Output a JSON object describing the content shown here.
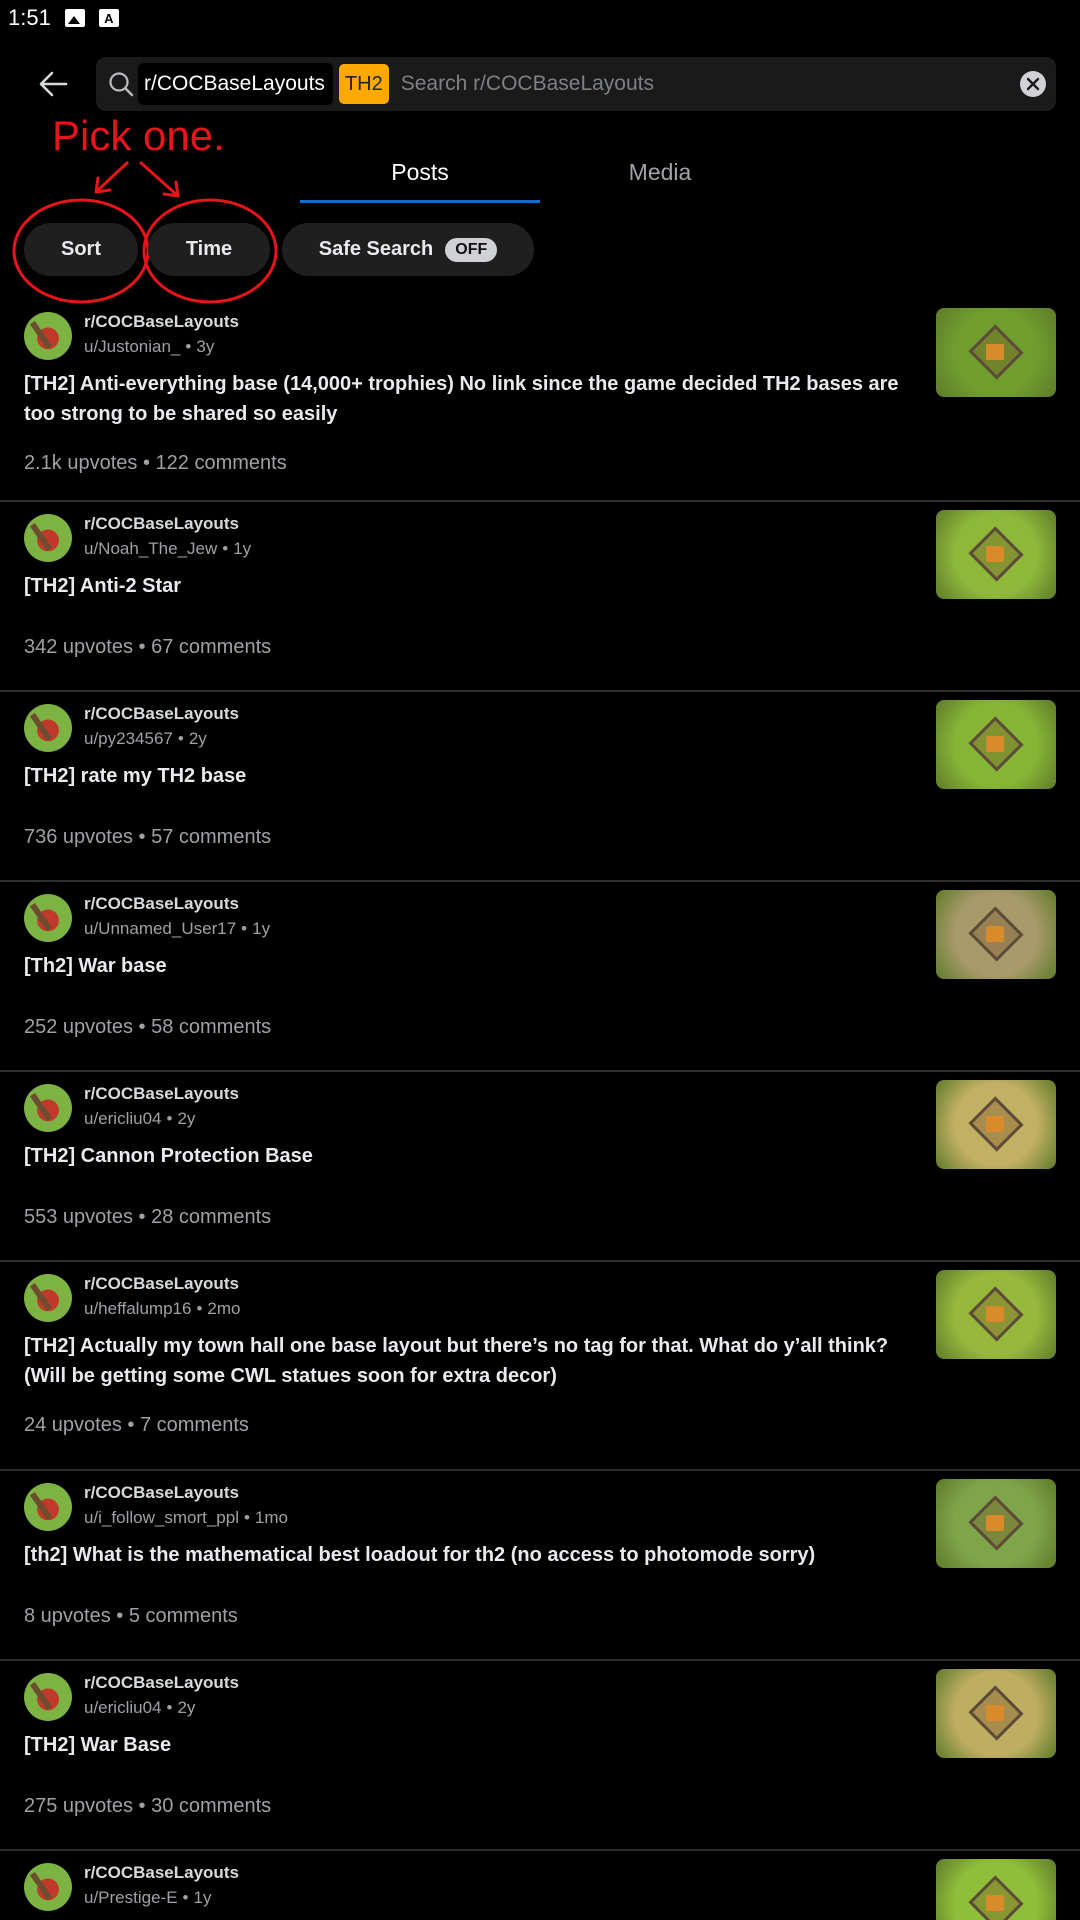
{
  "status_bar": {
    "time": "1:51"
  },
  "search": {
    "subreddit_chip": "r/COCBaseLayouts",
    "flair_chip": "TH2",
    "placeholder": "Search r/COCBaseLayouts"
  },
  "annotation": {
    "text": "Pick one.",
    "color": "#e8141b"
  },
  "tabs": [
    {
      "label": "Posts",
      "active": true
    },
    {
      "label": "Media",
      "active": false
    }
  ],
  "filters": {
    "sort": "Sort",
    "time": "Time",
    "safe_search": "Safe Search",
    "safe_search_state": "OFF"
  },
  "accent_color": "#0a6fcf",
  "posts": [
    {
      "subreddit": "r/COCBaseLayouts",
      "author": "u/Justonian_",
      "age": "3y",
      "title": "[TH2] Anti-everything base (14,000+ trophies) No link since the game decided TH2 bases are too strong to be shared so easily",
      "stats": "2.1k upvotes • 122 comments",
      "thumb_color": "#6f9e2e"
    },
    {
      "subreddit": "r/COCBaseLayouts",
      "author": "u/Noah_The_Jew",
      "age": "1y",
      "title": "[TH2] Anti-2 Star",
      "stats": "342 upvotes • 67 comments",
      "thumb_color": "#8db83a"
    },
    {
      "subreddit": "r/COCBaseLayouts",
      "author": "u/py234567",
      "age": "2y",
      "title": "[TH2] rate my TH2 base",
      "stats": "736 upvotes • 57 comments",
      "thumb_color": "#86b536"
    },
    {
      "subreddit": "r/COCBaseLayouts",
      "author": "u/Unnamed_User17",
      "age": "1y",
      "title": "[Th2] War base",
      "stats": "252 upvotes • 58 comments",
      "thumb_color": "#a89a6a"
    },
    {
      "subreddit": "r/COCBaseLayouts",
      "author": "u/ericliu04",
      "age": "2y",
      "title": "[TH2] Cannon Protection Base",
      "stats": "553 upvotes • 28 comments",
      "thumb_color": "#c2b063"
    },
    {
      "subreddit": "r/COCBaseLayouts",
      "author": "u/heffalump16",
      "age": "2mo",
      "title": "[TH2] Actually my town hall one base layout but there’s no tag for that. What do y’all think? (Will be getting some CWL statues soon for extra decor)",
      "stats": "24 upvotes • 7 comments",
      "thumb_color": "#97b83d"
    },
    {
      "subreddit": "r/COCBaseLayouts",
      "author": "u/i_follow_smort_ppl",
      "age": "1mo",
      "title": "[th2] What is the mathematical best loadout for th2 (no access to photomode sorry)",
      "stats": "8 upvotes • 5 comments",
      "thumb_color": "#7fa54a"
    },
    {
      "subreddit": "r/COCBaseLayouts",
      "author": "u/ericliu04",
      "age": "2y",
      "title": "[TH2] War Base",
      "stats": "275 upvotes • 30 comments",
      "thumb_color": "#bfae62"
    },
    {
      "subreddit": "r/COCBaseLayouts",
      "author": "u/Prestige-E",
      "age": "1y",
      "title": "",
      "stats": "",
      "thumb_color": "#8fbf3a"
    }
  ]
}
